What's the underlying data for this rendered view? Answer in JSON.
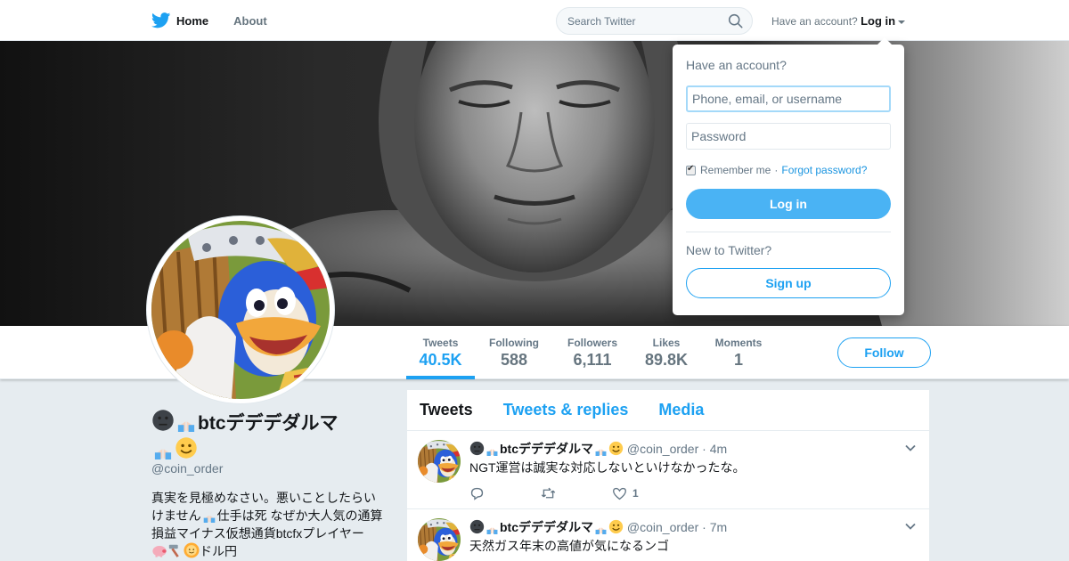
{
  "nav": {
    "home_label": "Home",
    "about_label": "About",
    "search_placeholder": "Search Twitter",
    "login_prompt": "Have an account?",
    "login_label": "Log in"
  },
  "profile": {
    "name": "btcデデデダルマ",
    "handle": "@coin_order",
    "bio_line1": "真実を見極めなさい。悪いことしたらい",
    "bio_line2": "けません",
    "bio_line3": "仕手は死 なぜか大人気の通",
    "bio_line4": "算損益マイナス仮想通貨btcfxプレイヤー",
    "bio_line5": "ドル円",
    "follow_label": "Follow"
  },
  "stats": [
    {
      "label": "Tweets",
      "value": "40.5K"
    },
    {
      "label": "Following",
      "value": "588"
    },
    {
      "label": "Followers",
      "value": "6,111"
    },
    {
      "label": "Likes",
      "value": "89.8K"
    },
    {
      "label": "Moments",
      "value": "1"
    }
  ],
  "timeline": {
    "tabs": [
      "Tweets",
      "Tweets & replies",
      "Media"
    ],
    "tweets": [
      {
        "name": "btcデデデダルマ",
        "handle": "@coin_order",
        "time": "4m",
        "text": "NGT運営は誠実な対応しないといけなかったな。",
        "likes": "1"
      },
      {
        "name": "btcデデデダルマ",
        "handle": "@coin_order",
        "time": "7m",
        "text": "天然ガス年末の高値が気になるンゴ",
        "likes": ""
      }
    ]
  },
  "login": {
    "title": "Have an account?",
    "username_placeholder": "Phone, email, or username",
    "password_placeholder": "Password",
    "remember_label": "Remember me",
    "separator": "·",
    "forgot_label": "Forgot password?",
    "login_button": "Log in",
    "new_prompt": "New to Twitter?",
    "signup_button": "Sign up"
  },
  "colors": {
    "accent": "#1da1f2",
    "login_button": "#4ab3f4",
    "background": "#e6ecf0"
  }
}
